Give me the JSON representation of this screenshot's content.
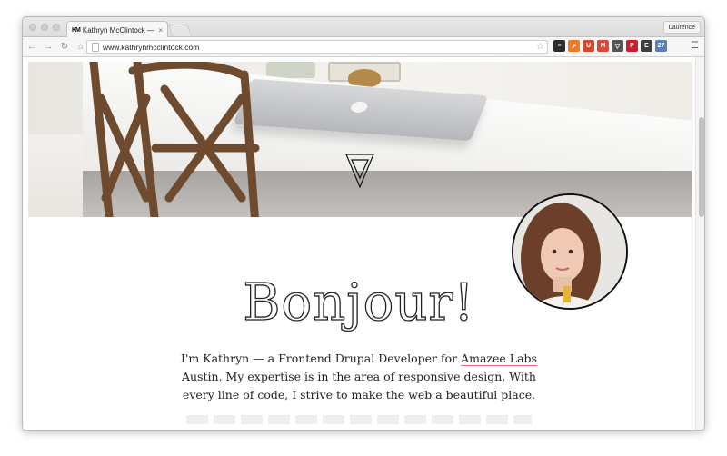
{
  "browser": {
    "tab_title": "Kathryn McClintock — Drup",
    "tab_favicon": "KM",
    "tab_close": "×",
    "profile_name": "Laurence",
    "url": "www.kathrynmcclintock.com",
    "extensions": [
      {
        "name": "buffer-icon",
        "color": "#2b2b2b",
        "glyph": "≡"
      },
      {
        "name": "feedly-icon",
        "color": "#f07a25",
        "glyph": "↗"
      },
      {
        "name": "ublock-icon",
        "color": "#d14b2f",
        "glyph": "U"
      },
      {
        "name": "gmail-icon",
        "color": "#d9483b",
        "glyph": "M"
      },
      {
        "name": "pocket-icon",
        "color": "#555555",
        "glyph": "▽"
      },
      {
        "name": "pinterest-icon",
        "color": "#cb2027",
        "glyph": "P"
      },
      {
        "name": "evernote-icon",
        "color": "#3e3e3e",
        "glyph": "E"
      },
      {
        "name": "calendar-icon",
        "color": "#5a7fb5",
        "glyph": "27"
      }
    ]
  },
  "page": {
    "greeting": "Bonjour!",
    "intro_before": "I'm Kathryn — a Frontend Drupal Developer for ",
    "intro_link": "Amazee Labs",
    "intro_after": " Austin. My expertise is in the area of responsive design. With every line of code, I strive to make the web a beautiful place."
  }
}
